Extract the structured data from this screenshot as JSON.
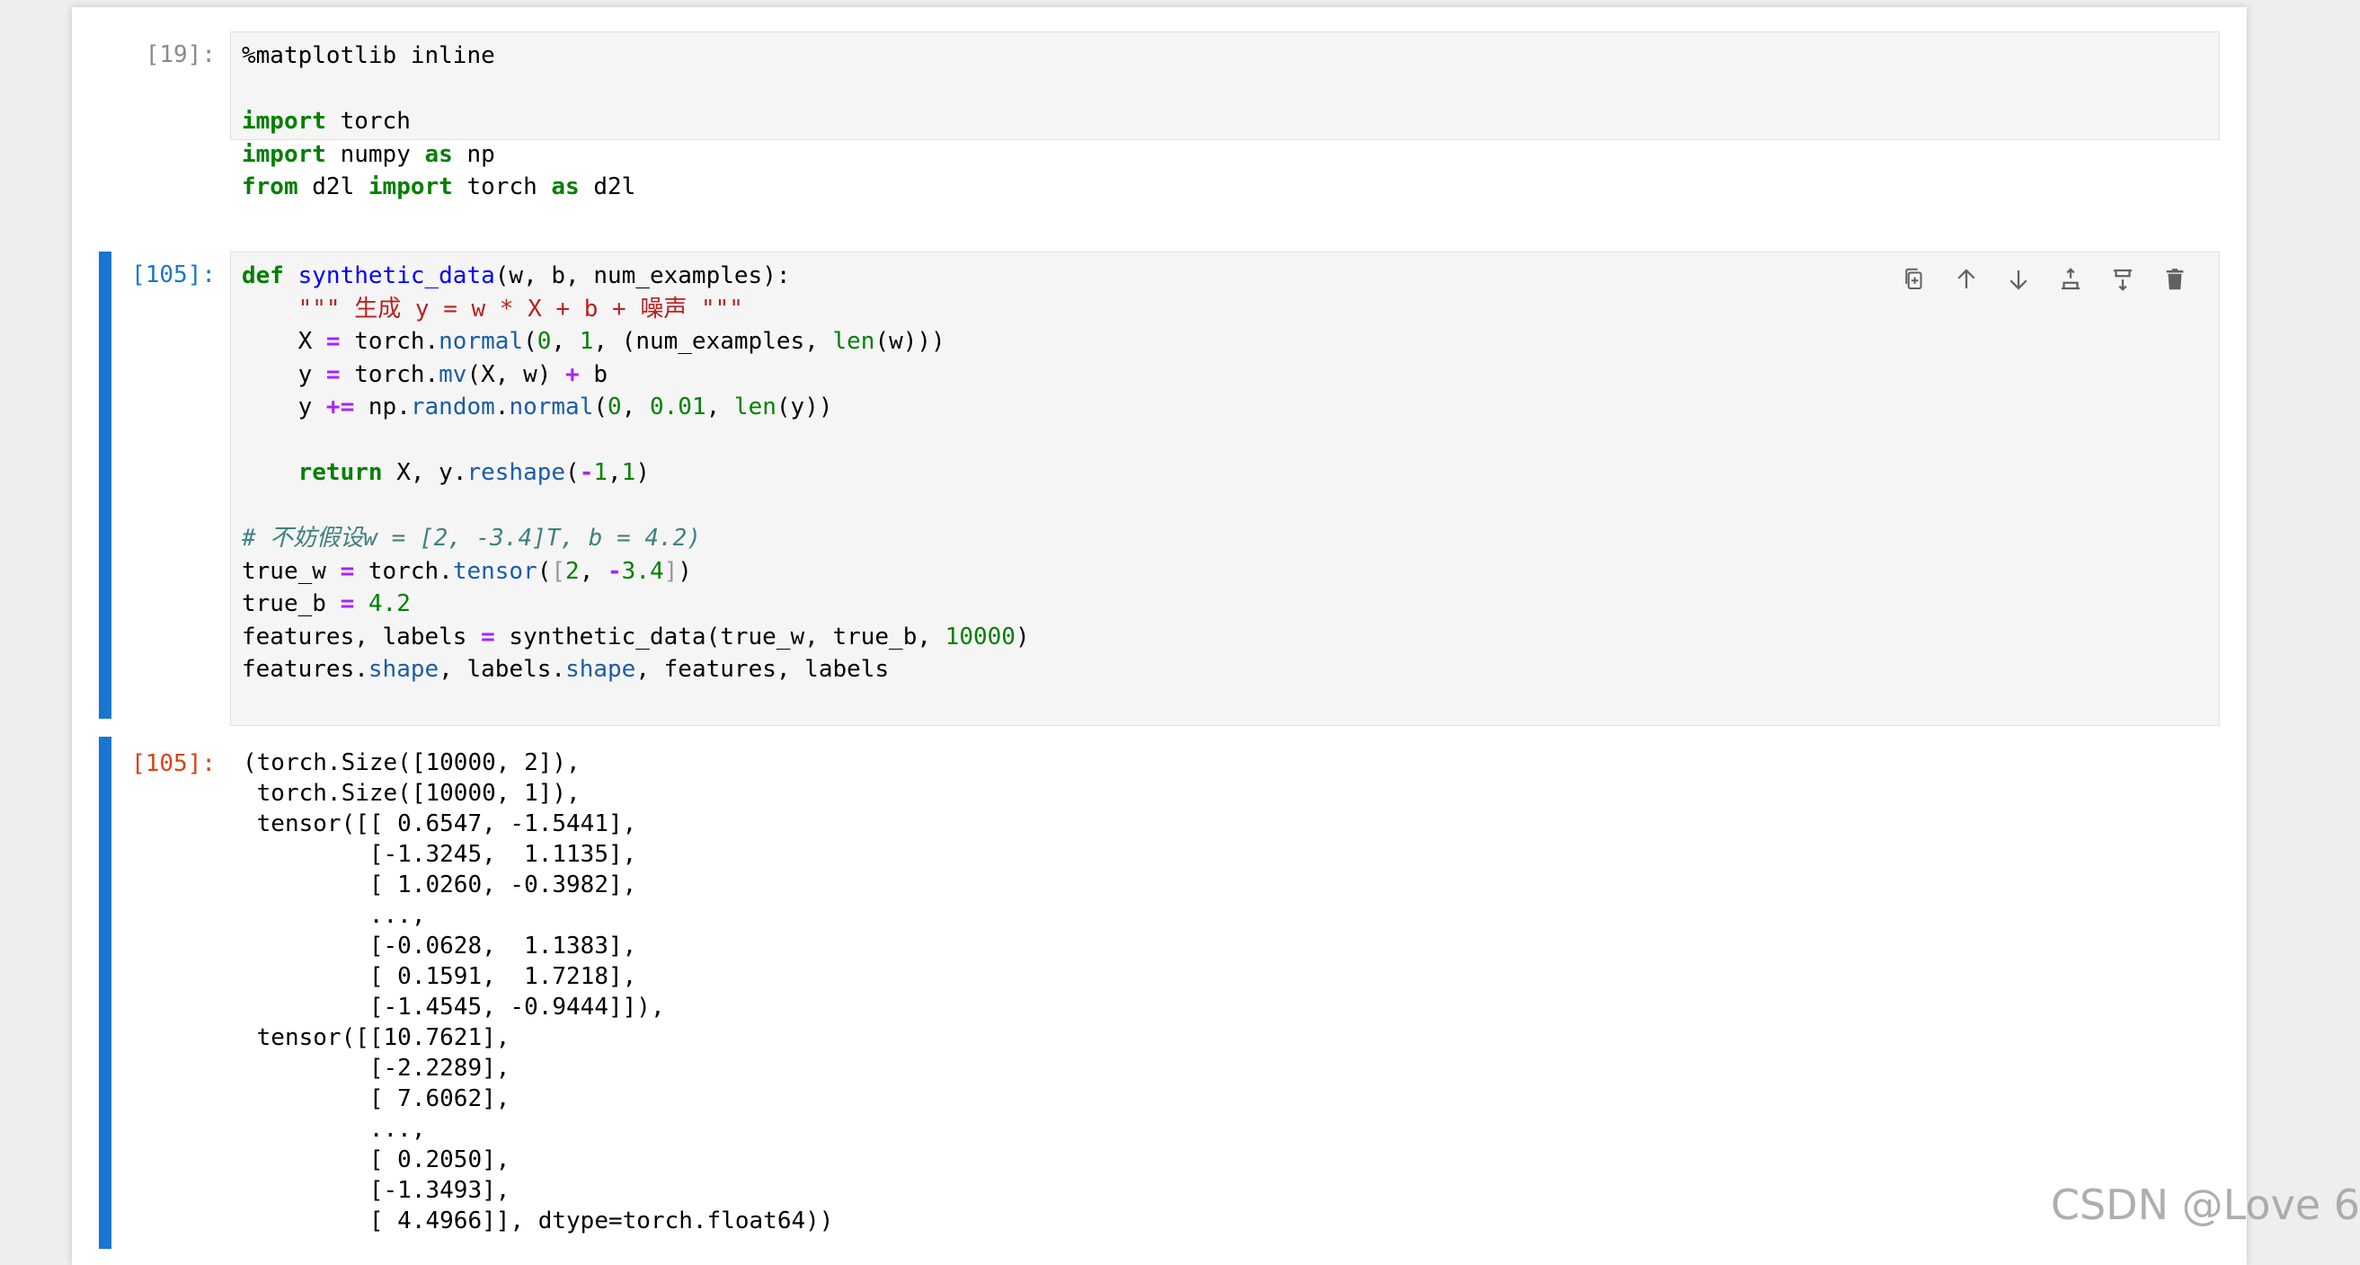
{
  "cells": {
    "c1": {
      "prompt": "[19]:"
    },
    "c2": {
      "prompt": "[105]:"
    },
    "c3": {
      "prompt": "[105]:"
    }
  },
  "code1": {
    "l1": "%matplotlib inline",
    "l3a": "import",
    "l3b": " torch",
    "l4a": "import",
    "l4b": " numpy ",
    "l4c": "as",
    "l4d": " np",
    "l5a": "from",
    "l5b": " d2l ",
    "l5c": "import",
    "l5d": " torch ",
    "l5e": "as",
    "l5f": " d2l"
  },
  "code2": {
    "a1": "def",
    "a2": " ",
    "a3": "synthetic_data",
    "a4": "(w, b, num_examples):",
    "b1": "    ",
    "b2": "\"\"\" 生成 y = w * X + b + 噪声 \"\"\"",
    "c1": "    X ",
    "c2": "=",
    "c3": " torch.",
    "c4": "normal",
    "c5": "(",
    "c6": "0",
    "c7": ", ",
    "c8": "1",
    "c9": ", (num_examples, ",
    "c10": "len",
    "c11": "(w)))",
    "d1": "    y ",
    "d2": "=",
    "d3": " torch.",
    "d4": "mv",
    "d5": "(X, w) ",
    "d6": "+",
    "d7": " b",
    "e1": "    y ",
    "e2": "+=",
    "e3": " np.",
    "e4": "random",
    "e5": ".",
    "e6": "normal",
    "e7": "(",
    "e8": "0",
    "e9": ", ",
    "e10": "0.01",
    "e11": ", ",
    "e12": "len",
    "e13": "(y))",
    "g1": "    ",
    "g2": "return",
    "g3": " X, y.",
    "g4": "reshape",
    "g5": "(",
    "g6": "-",
    "g7": "1",
    "g8": ",",
    "g9": "1",
    "g10": ")",
    "i1": "# 不妨假设w = [2, -3.4]T, b = 4.2)",
    "j1": "true_w ",
    "j2": "=",
    "j3": " torch.",
    "j4": "tensor",
    "j5": "(",
    "j6": "[",
    "j7": "2",
    "j8": ", ",
    "j9": "-",
    "j10": "3.4",
    "j11": "]",
    "j12": ")",
    "k1": "true_b ",
    "k2": "=",
    "k3": " ",
    "k4": "4.2",
    "l1": "features, labels ",
    "l2": "=",
    "l3": " synthetic_data(true_w, true_b, ",
    "l4": "10000",
    "l5": ")",
    "m1": "features.",
    "m2": "shape",
    "m3": ", labels.",
    "m4": "shape",
    "m5": ", features, labels"
  },
  "output": {
    "text": "(torch.Size([10000, 2]),\n torch.Size([10000, 1]),\n tensor([[ 0.6547, -1.5441],\n         [-1.3245,  1.1135],\n         [ 1.0260, -0.3982],\n         ...,\n         [-0.0628,  1.1383],\n         [ 0.1591,  1.7218],\n         [-1.4545, -0.9444]]),\n tensor([[10.7621],\n         [-2.2289],\n         [ 7.6062],\n         ...,\n         [ 0.2050],\n         [-1.3493],\n         [ 4.4966]], dtype=torch.float64))"
  },
  "toolbar": {
    "icons": [
      "duplicate-icon",
      "move-up-icon",
      "move-down-icon",
      "insert-above-icon",
      "insert-below-icon",
      "delete-icon"
    ]
  },
  "watermark": "CSDN @Love 6",
  "colors": {
    "keyword": "#008000",
    "operator": "#aa22ff",
    "function": "#0000ff",
    "string": "#ba2121",
    "comment": "#408080",
    "active_collapser": "#1976d2",
    "output_prompt": "#d84315"
  }
}
